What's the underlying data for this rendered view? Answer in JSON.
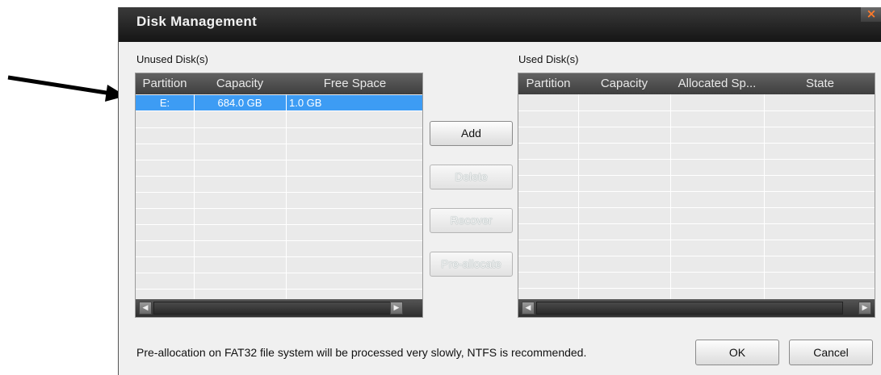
{
  "window": {
    "title": "Disk Management",
    "close_glyph": "×"
  },
  "unused": {
    "label": "Unused Disk(s)",
    "columns": [
      "Partition",
      "Capacity",
      "Free Space"
    ],
    "rows": [
      {
        "partition": "E:",
        "capacity": "684.0 GB",
        "free_space": "1.0 GB",
        "selected": true
      }
    ],
    "empty_row_count": 11
  },
  "used": {
    "label": "Used Disk(s)",
    "columns": [
      "Partition",
      "Capacity",
      "Allocated Sp...",
      "State"
    ],
    "rows": [],
    "empty_row_count": 12
  },
  "actions": {
    "add": "Add",
    "delete": "Delete",
    "recover": "Recover",
    "preallocate": "Pre-allocate"
  },
  "footer": {
    "note": "Pre-allocation on FAT32 file system will be processed very slowly, NTFS is recommended.",
    "ok": "OK",
    "cancel": "Cancel"
  },
  "scroll": {
    "left_glyph": "◀",
    "right_glyph": "▶"
  },
  "colors": {
    "selection": "#3d9cf4",
    "header": "#4a4a4a",
    "titlebar": "#1e1e1e",
    "close_accent": "#ff7a2a"
  }
}
